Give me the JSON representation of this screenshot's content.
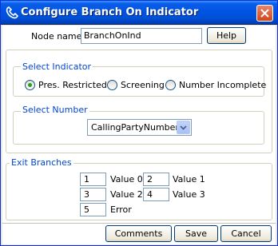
{
  "window": {
    "title": "Configure Branch On Indicator",
    "icon": "phone-handset-icon",
    "accent": "#0054e3"
  },
  "node": {
    "label": "Node name",
    "value": "BranchOnInd",
    "help_label": "Help"
  },
  "select_indicator": {
    "legend": "Select Indicator",
    "options": [
      {
        "label": "Pres. Restricted",
        "selected": true
      },
      {
        "label": "Screening",
        "selected": false
      },
      {
        "label": "Number Incomplete",
        "selected": false
      }
    ]
  },
  "select_number": {
    "legend": "Select Number",
    "value": "CallingPartyNumber"
  },
  "exit_branches": {
    "legend": "Exit Branches",
    "items": [
      {
        "id": "1",
        "label": "Value 0"
      },
      {
        "id": "2",
        "label": "Value 1"
      },
      {
        "id": "3",
        "label": "Value 2"
      },
      {
        "id": "4",
        "label": "Value 3"
      },
      {
        "id": "5",
        "label": "Error"
      }
    ]
  },
  "footer": {
    "comments_label": "Comments",
    "save_label": "Save",
    "cancel_label": "Cancel"
  }
}
